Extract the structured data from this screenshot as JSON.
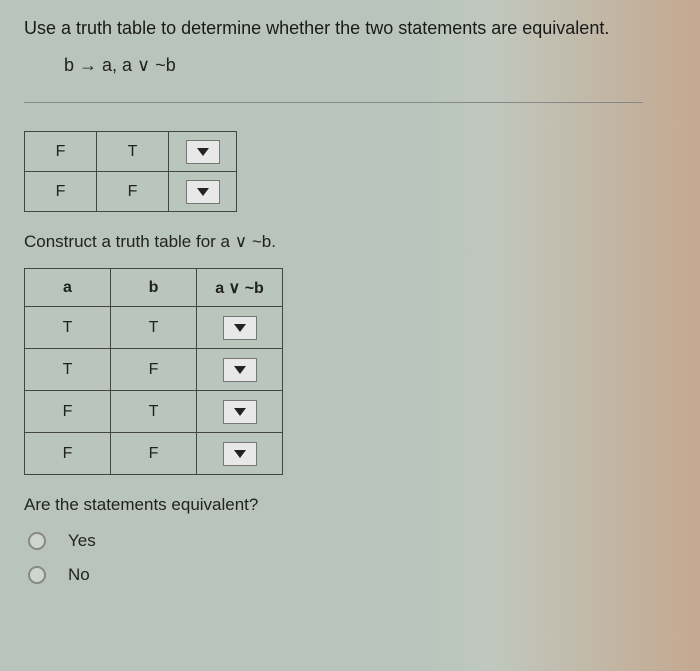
{
  "question": "Use a truth table to determine whether the two statements are equivalent.",
  "formula": "b → a, a ∨ ~b",
  "partial_table": {
    "rows": [
      {
        "c1": "F",
        "c2": "T"
      },
      {
        "c1": "F",
        "c2": "F"
      }
    ]
  },
  "instruction1": "Construct a truth table for a ∨ ~b.",
  "truth_table": {
    "headers": {
      "a": "a",
      "b": "b",
      "expr": "a ∨ ~b"
    },
    "rows": [
      {
        "a": "T",
        "b": "T"
      },
      {
        "a": "T",
        "b": "F"
      },
      {
        "a": "F",
        "b": "T"
      },
      {
        "a": "F",
        "b": "F"
      }
    ]
  },
  "question2": "Are the statements equivalent?",
  "options": {
    "yes": "Yes",
    "no": "No"
  },
  "chart_data": {
    "type": "table",
    "description": "Truth table construction exercise for logical equivalence of b→a and a∨~b",
    "partial_rows": [
      [
        "F",
        "T",
        null
      ],
      [
        "F",
        "F",
        null
      ]
    ],
    "main_headers": [
      "a",
      "b",
      "a ∨ ~b"
    ],
    "main_rows": [
      [
        "T",
        "T",
        null
      ],
      [
        "T",
        "F",
        null
      ],
      [
        "F",
        "T",
        null
      ],
      [
        "F",
        "F",
        null
      ]
    ]
  }
}
